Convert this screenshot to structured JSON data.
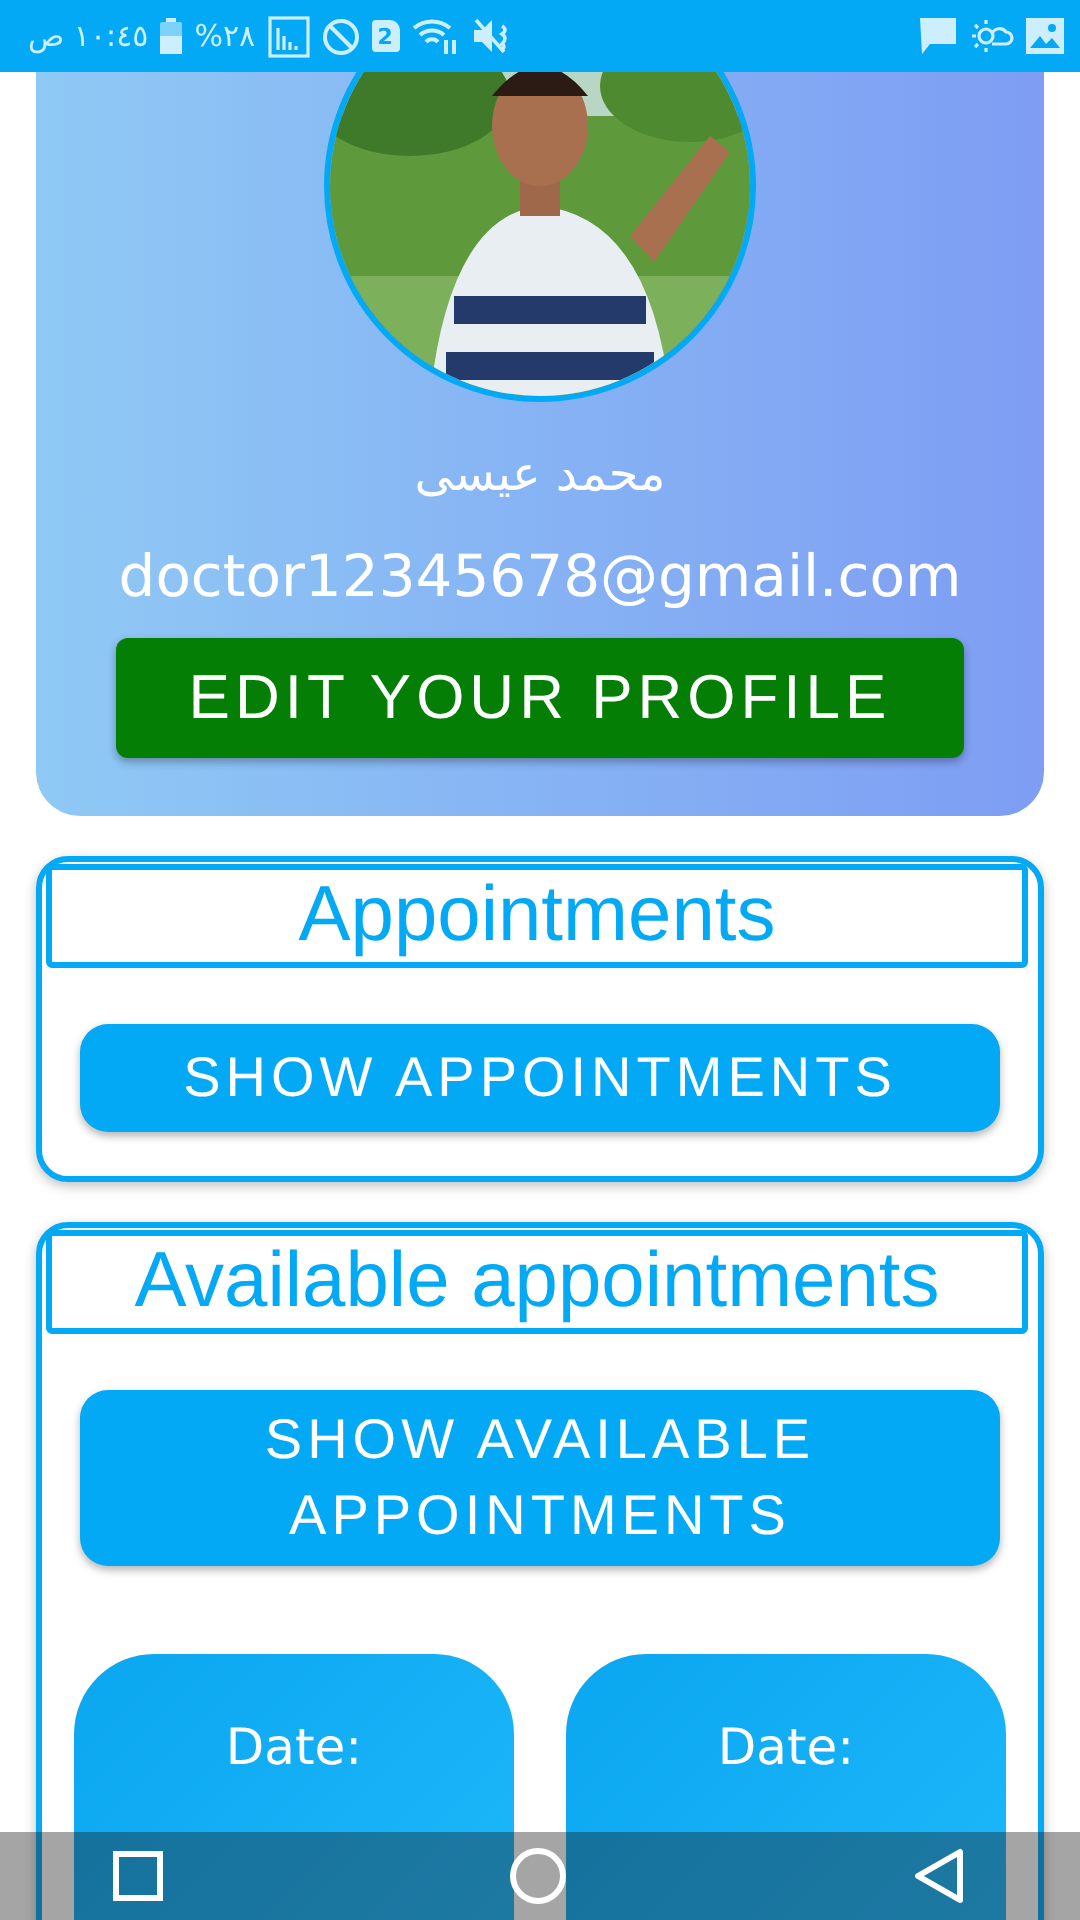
{
  "status_bar": {
    "time": "١٠:٤٥ ص",
    "battery": "%٢٨",
    "sim_slot": "2"
  },
  "profile": {
    "name": "محمد عيسى",
    "email": "doctor12345678@gmail.com",
    "edit_button": "EDIT YOUR PROFILE"
  },
  "sections": [
    {
      "title": "Appointments",
      "button": "SHOW APPOINTMENTS"
    },
    {
      "title": "Available appointments",
      "button": "SHOW AVAILABLE APPOINTMENTS",
      "slots": [
        {
          "label": "Date:"
        },
        {
          "label": "Date:"
        }
      ]
    }
  ]
}
